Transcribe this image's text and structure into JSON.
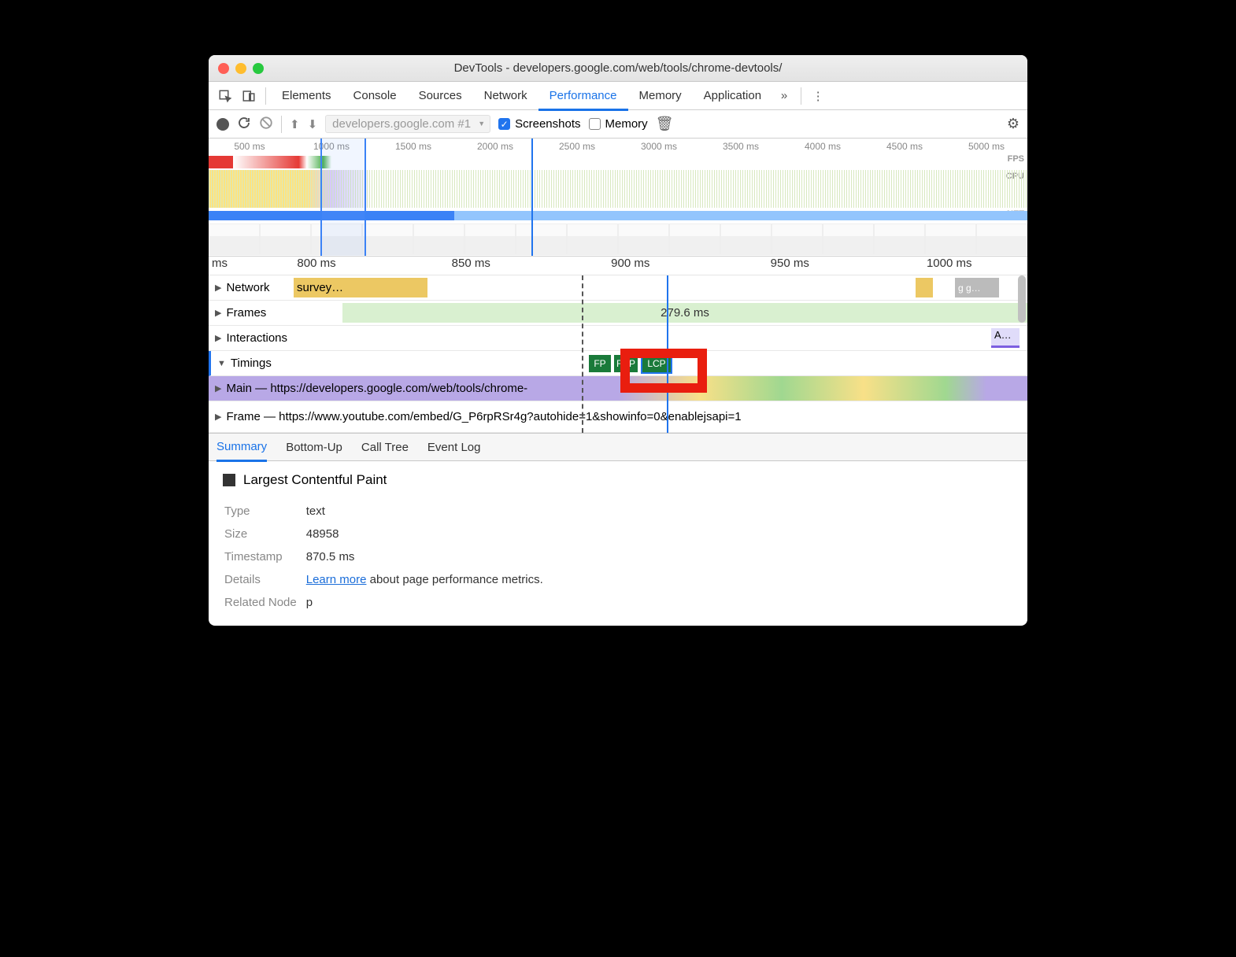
{
  "window": {
    "title": "DevTools - developers.google.com/web/tools/chrome-devtools/"
  },
  "tabs": {
    "elements": "Elements",
    "console": "Console",
    "sources": "Sources",
    "network": "Network",
    "performance": "Performance",
    "memory": "Memory",
    "application": "Application"
  },
  "toolbar": {
    "recording_dropdown": "developers.google.com #1",
    "screenshots": "Screenshots",
    "memory": "Memory"
  },
  "overview_ticks": [
    "500 ms",
    "1000 ms",
    "1500 ms",
    "2000 ms",
    "2500 ms",
    "3000 ms",
    "3500 ms",
    "4000 ms",
    "4500 ms",
    "5000 ms"
  ],
  "overview_labels": {
    "fps": "FPS",
    "cpu": "CPU",
    "net": "NET"
  },
  "ruler2": [
    "ms",
    "800 ms",
    "850 ms",
    "900 ms",
    "950 ms",
    "1000 ms"
  ],
  "tracks": {
    "network": "Network",
    "network_item": "survey…",
    "gg_label": "g g…",
    "frames": "Frames",
    "frames_duration": "279.6 ms",
    "interactions": "Interactions",
    "interactions_a": "A…",
    "timings": "Timings",
    "fp": "FP",
    "fcp": "FCP",
    "lcp": "LCP",
    "main": "Main — https://developers.google.com/web/tools/chrome-",
    "frame": "Frame — https://www.youtube.com/embed/G_P6rpRSr4g?autohide=1&showinfo=0&enablejsapi=1"
  },
  "detail_tabs": {
    "summary": "Summary",
    "bottomup": "Bottom-Up",
    "calltree": "Call Tree",
    "eventlog": "Event Log"
  },
  "summary": {
    "title": "Largest Contentful Paint",
    "type_label": "Type",
    "type_value": "text",
    "size_label": "Size",
    "size_value": "48958",
    "timestamp_label": "Timestamp",
    "timestamp_value": "870.5 ms",
    "details_label": "Details",
    "learn_more": "Learn more",
    "details_rest": " about page performance metrics.",
    "related_label": "Related Node",
    "related_value": "p"
  }
}
